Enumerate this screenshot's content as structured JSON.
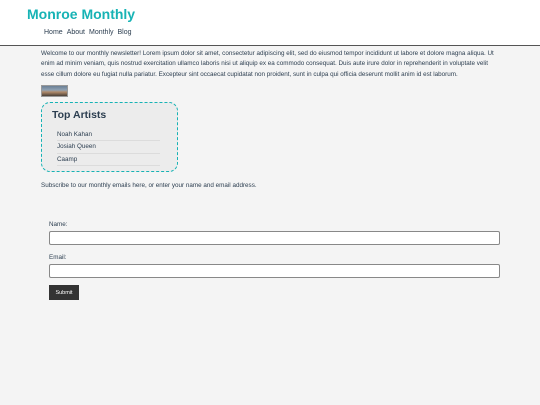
{
  "site": {
    "title": "Monroe Monthly"
  },
  "nav": {
    "items": [
      "Home",
      "About",
      "Monthly",
      "Blog"
    ]
  },
  "intro": {
    "text": "Welcome to our monthly newsletter! Lorem ipsum dolor sit amet, consectetur adipiscing elit, sed do eiusmod tempor incididunt ut labore et dolore magna aliqua. Ut enim ad minim veniam, quis nostrud exercitation ullamco laboris nisi ut aliquip ex ea commodo consequat. Duis aute irure dolor in reprehenderit in voluptate velit esse cillum dolore eu fugiat nulla pariatur. Excepteur sint occaecat cupidatat non proident, sunt in culpa qui officia deserunt mollit anim id est laborum."
  },
  "artists": {
    "title": "Top Artists",
    "items": [
      "Noah Kahan",
      "Josiah Queen",
      "Caamp"
    ]
  },
  "subscribe": {
    "text": "Subscribe to our monthly emails here, or enter your name and email address."
  },
  "form": {
    "name_label": "Name:",
    "name_value": "",
    "email_label": "Email:",
    "email_value": "",
    "submit_label": "Submit"
  },
  "colors": {
    "accent": "#17b3b5",
    "text": "#2c3e50",
    "background": "#f4f4f4",
    "button": "#333333"
  }
}
